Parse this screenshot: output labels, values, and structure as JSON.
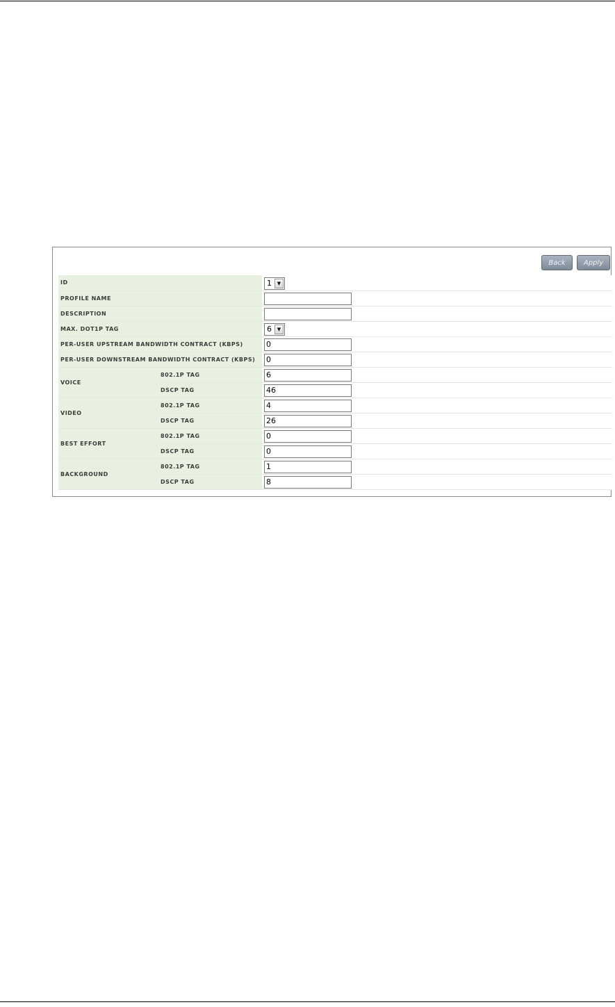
{
  "toolbar": {
    "back_label": "Back",
    "apply_label": "Apply"
  },
  "fields": {
    "id": {
      "label": "ID",
      "value": "1"
    },
    "profile_name": {
      "label": "PROFILE NAME",
      "value": ""
    },
    "description": {
      "label": "DESCRIPTION",
      "value": ""
    },
    "max_dot1p": {
      "label": "MAX. DOT1P TAG",
      "value": "6"
    },
    "upstream": {
      "label": "PER-USER UPSTREAM BANDWIDTH CONTRACT (KBPS)",
      "value": "0"
    },
    "downstream": {
      "label": "PER-USER DOWNSTREAM BANDWIDTH CONTRACT (KBPS)",
      "value": "0"
    }
  },
  "classes": [
    {
      "name": "VOICE",
      "dot1p_label": "802.1P TAG",
      "dot1p": "6",
      "dscp_label": "DSCP TAG",
      "dscp": "46"
    },
    {
      "name": "VIDEO",
      "dot1p_label": "802.1P TAG",
      "dot1p": "4",
      "dscp_label": "DSCP TAG",
      "dscp": "26"
    },
    {
      "name": "BEST EFFORT",
      "dot1p_label": "802.1P TAG",
      "dot1p": "0",
      "dscp_label": "DSCP TAG",
      "dscp": "0"
    },
    {
      "name": "BACKGROUND",
      "dot1p_label": "802.1P TAG",
      "dot1p": "1",
      "dscp_label": "DSCP TAG",
      "dscp": "8"
    }
  ],
  "icons": {
    "dropdown": "chevron-down-icon"
  }
}
